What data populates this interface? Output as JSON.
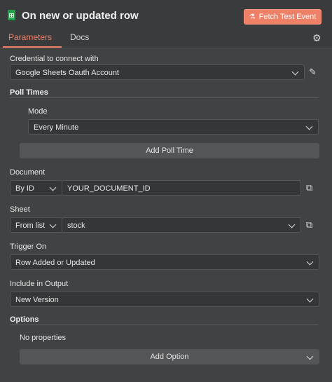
{
  "header": {
    "title": "On new or updated row",
    "fetch_label": "Fetch Test Event"
  },
  "tabs": [
    {
      "label": "Parameters"
    },
    {
      "label": "Docs"
    }
  ],
  "credential": {
    "label": "Credential to connect with",
    "value": "Google Sheets Oauth Account"
  },
  "poll_times": {
    "section": "Poll Times",
    "mode_label": "Mode",
    "mode_value": "Every Minute",
    "add_label": "Add Poll Time"
  },
  "document": {
    "label": "Document",
    "type": "By ID",
    "value": "YOUR_DOCUMENT_ID"
  },
  "sheet": {
    "label": "Sheet",
    "type": "From list",
    "value": "stock"
  },
  "trigger": {
    "label": "Trigger On",
    "value": "Row Added or Updated"
  },
  "output": {
    "label": "Include in Output",
    "value": "New Version"
  },
  "options": {
    "section": "Options",
    "empty_text": "No properties",
    "add_label": "Add Option"
  }
}
